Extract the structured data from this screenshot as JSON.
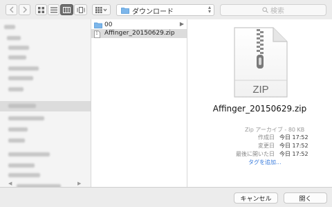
{
  "toolbar": {
    "back_icon": "chevron-left-icon",
    "forward_icon": "chevron-right-icon",
    "view_icons": [
      "icon-view-icon",
      "list-view-icon",
      "column-view-icon",
      "cover-flow-icon"
    ],
    "arrange_icon": "arrange-grid-icon",
    "path_label": "ダウンロード",
    "search_placeholder": "検索"
  },
  "sidebar": {
    "note": "sidebar items are blurred/unreadable"
  },
  "column": {
    "items": [
      {
        "name": "00",
        "type": "folder",
        "has_children": true,
        "selected": false
      },
      {
        "name": "Affinger_20150629.zip",
        "type": "zip",
        "has_children": false,
        "selected": true
      }
    ]
  },
  "preview": {
    "icon_label": "ZIP",
    "file_name": "Affinger_20150629.zip",
    "kind": "Zip アーカイブ - 80 KB",
    "info": [
      {
        "key": "作成日",
        "value": "今日 17:52"
      },
      {
        "key": "変更日",
        "value": "今日 17:52"
      },
      {
        "key": "最後に開いた日",
        "value": "今日 17:52"
      }
    ],
    "add_tags": "タグを追加..."
  },
  "buttons": {
    "cancel": "キャンセル",
    "open": "開く"
  },
  "colors": {
    "window_bg": "#ececec",
    "selection": "#dcdcdc",
    "link": "#3b7ddd",
    "active_view": "#6d6d6d"
  }
}
